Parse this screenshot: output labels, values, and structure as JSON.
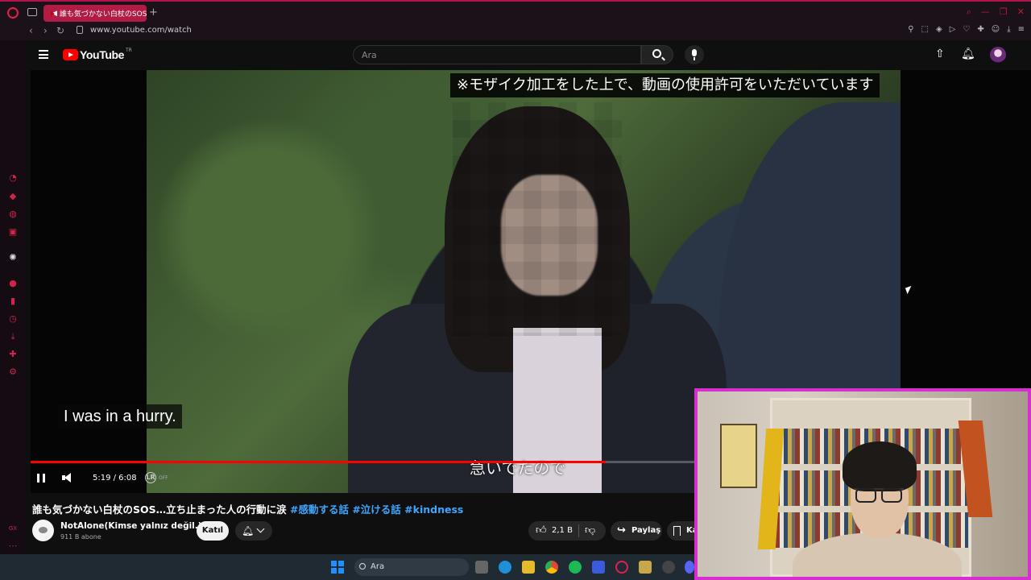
{
  "browser": {
    "tab_title": "誰も気づかない白杖のSOS",
    "new_tab": "+",
    "url": "www.youtube.com/watch"
  },
  "youtube": {
    "logo_text": "YouTube",
    "logo_region": "TR",
    "search_placeholder": "Ara"
  },
  "video": {
    "notice": "※モザイク加工をした上で、動画の使用許可をいただいています",
    "caption_en": "I was in a hurry.",
    "caption_jp": "急いでたので",
    "time": "5:19 / 6:08",
    "progress_fraction": 0.867,
    "lr_label": "LR",
    "lr_state": "OFF"
  },
  "details": {
    "title_main": "誰も気づかない白杖のSOS…立ち止まった人の行動に涙 ",
    "title_tags": "#感動する話 #泣ける話 #kindness",
    "channel_name": "NotAlone(Kimse yalnız değil.)",
    "subscribers": "911 B abone",
    "join_label": "Katıl",
    "likes": "2,1 B",
    "share_label": "Paylaş",
    "save_label": "Kaydet"
  },
  "taskbar": {
    "search_label": "Ara"
  },
  "colors": {
    "accent": "#ff0000",
    "opera": "#d0234d",
    "cam_border": "#d62fd0",
    "link": "#3ea6ff"
  }
}
